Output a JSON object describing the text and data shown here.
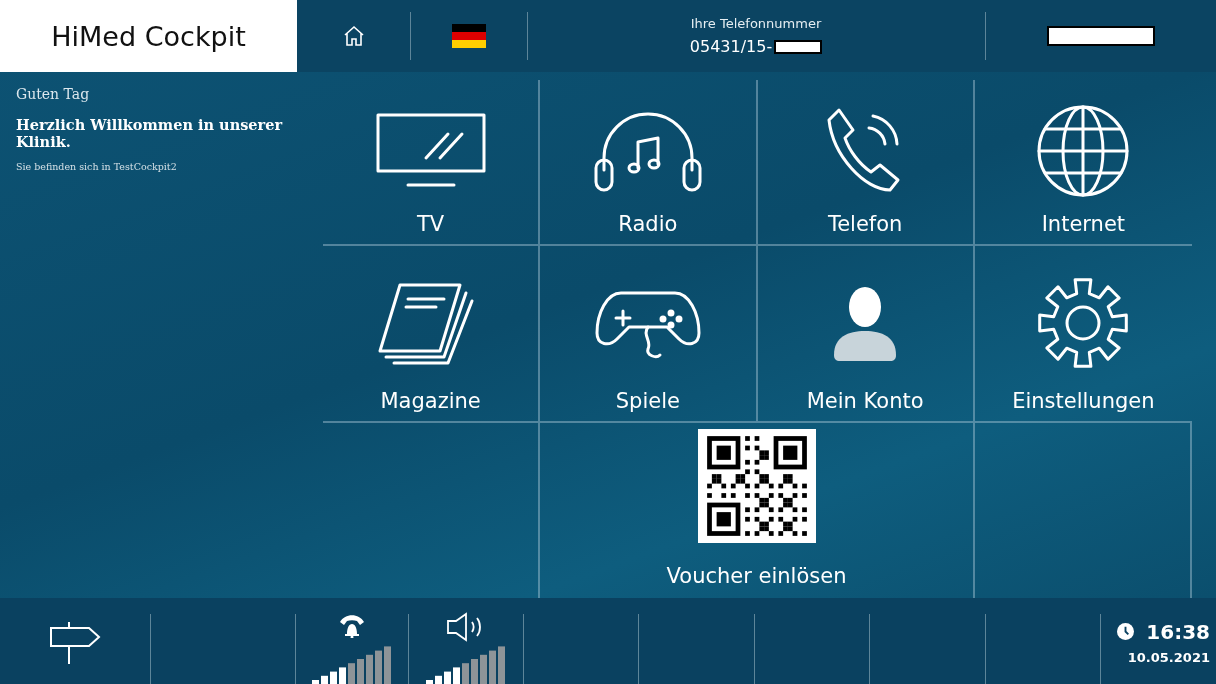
{
  "header": {
    "logo": "HiMed Cockpit",
    "phone_label": "Ihre Telefonnummer",
    "phone_number": "05431/15-"
  },
  "welcome": {
    "greeting": "Guten Tag",
    "headline": "Herzlich Willkommen in unserer Klinik.",
    "location": "Sie befinden sich in TestCockpit2"
  },
  "tiles": [
    {
      "kind": "tv",
      "label": "TV"
    },
    {
      "kind": "radio",
      "label": "Radio"
    },
    {
      "kind": "phone",
      "label": "Telefon"
    },
    {
      "kind": "globe",
      "label": "Internet"
    },
    {
      "kind": "magazine",
      "label": "Magazine"
    },
    {
      "kind": "gamepad",
      "label": "Spiele"
    },
    {
      "kind": "person",
      "label": "Mein Konto"
    },
    {
      "kind": "gear",
      "label": "Einstellungen"
    }
  ],
  "voucher": {
    "label": "Voucher einlösen"
  },
  "footer": {
    "ringer": {
      "level": 0.44
    },
    "speaker": {
      "level": 0.44
    },
    "time": "16:38",
    "date": "10.05.2021"
  }
}
